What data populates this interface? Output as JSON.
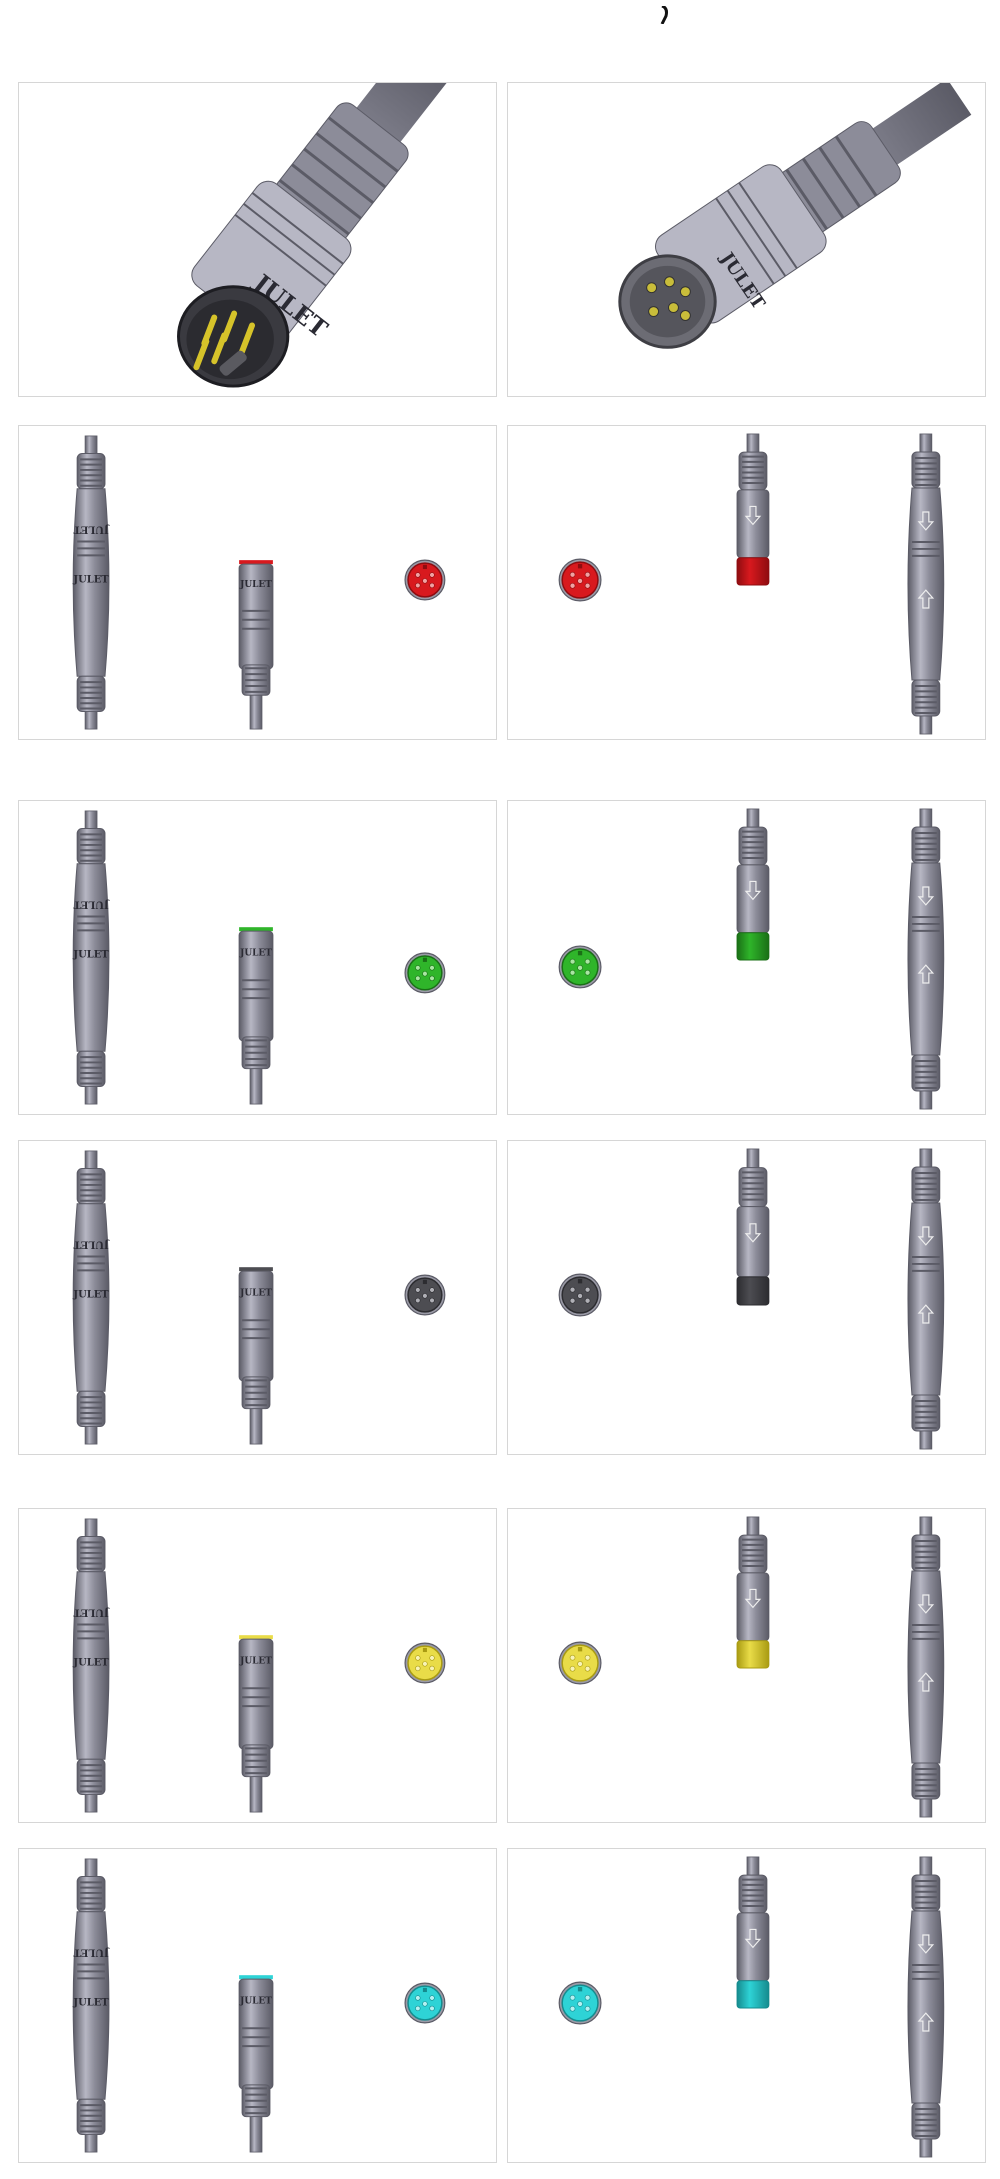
{
  "brand_text": "JULET",
  "colors": {
    "body": "#8c8c99",
    "body_dark": "#5b5b66",
    "body_light": "#b7b7c4",
    "panel_border": "#d6d6d6"
  },
  "rows": [
    {
      "id": "red",
      "accent": "#d8191e",
      "accent_dark": "#8e0c10",
      "face_pin": "#f1a2a2"
    },
    {
      "id": "green",
      "accent": "#2fb52a",
      "accent_dark": "#1a6f16",
      "face_pin": "#a9e6a3"
    },
    {
      "id": "gray",
      "accent": "#4d4d52",
      "accent_dark": "#2c2c30",
      "face_pin": "#b0b0b6"
    },
    {
      "id": "yellow",
      "accent": "#e9dc48",
      "accent_dark": "#a99b12",
      "face_pin": "#f8f3b6"
    },
    {
      "id": "cyan",
      "accent": "#2ed3d6",
      "accent_dark": "#158b8e",
      "face_pin": "#b4f1f2"
    }
  ]
}
